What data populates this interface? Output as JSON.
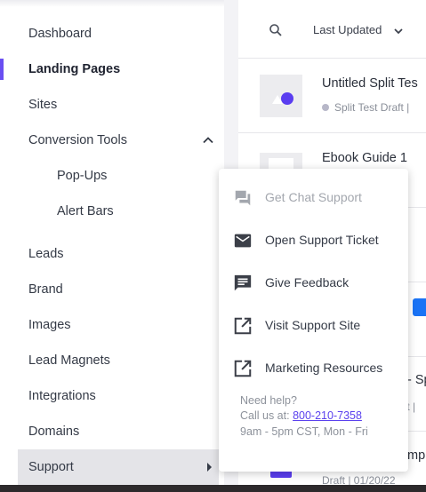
{
  "sidebar": {
    "items": [
      {
        "label": "Dashboard"
      },
      {
        "label": "Landing Pages"
      },
      {
        "label": "Sites"
      },
      {
        "label": "Conversion Tools"
      },
      {
        "label": "Pop-Ups"
      },
      {
        "label": "Alert Bars"
      },
      {
        "label": "Leads"
      },
      {
        "label": "Brand"
      },
      {
        "label": "Images"
      },
      {
        "label": "Lead Magnets"
      },
      {
        "label": "Integrations"
      },
      {
        "label": "Domains"
      },
      {
        "label": "Support"
      }
    ],
    "active": "Landing Pages"
  },
  "toolbar": {
    "sort_label": "Last Updated"
  },
  "pages": {
    "rows": [
      {
        "title": "Untitled Split Tes",
        "status": "Split Test Draft |"
      },
      {
        "title": "Ebook Guide 1"
      }
    ],
    "partial": [
      {
        "text": "- Sp"
      },
      {
        "text": "ft |"
      },
      {
        "text": "mp"
      },
      {
        "text": "Draft | 01/20/22"
      }
    ]
  },
  "support_menu": {
    "items": [
      {
        "label": "Get Chat Support",
        "icon": "chat-icon",
        "disabled": true
      },
      {
        "label": "Open Support Ticket",
        "icon": "mail-icon",
        "disabled": false
      },
      {
        "label": "Give Feedback",
        "icon": "feedback-icon",
        "disabled": false
      },
      {
        "label": "Visit Support Site",
        "icon": "external-link-icon",
        "disabled": false
      },
      {
        "label": "Marketing Resources",
        "icon": "external-link-icon",
        "disabled": false
      }
    ],
    "help": {
      "title": "Need help?",
      "call_prefix": "Call us at:",
      "phone": "800-210-7358",
      "hours": "9am - 5pm CST, Mon - Fri"
    }
  },
  "colors": {
    "accent": "#6a4ff2",
    "link": "#5b42ee",
    "button_blue": "#1a73f5"
  }
}
